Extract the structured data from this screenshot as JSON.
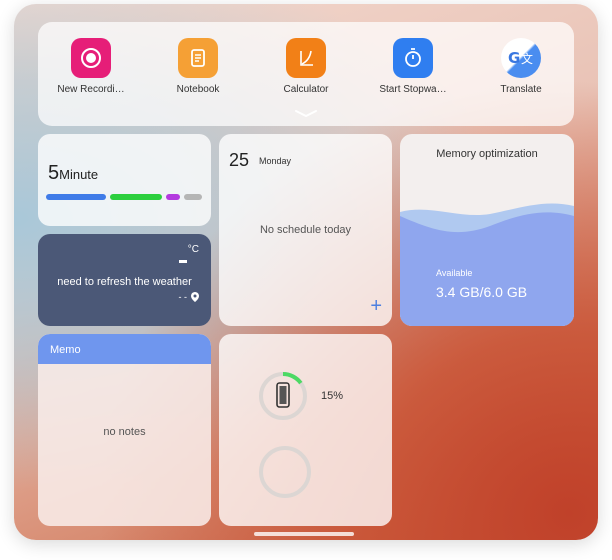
{
  "apps": [
    {
      "label": "New Recordi…",
      "icon": "record-icon",
      "color": "#e61e78"
    },
    {
      "label": "Notebook",
      "icon": "notebook-icon",
      "color": "#f5a035"
    },
    {
      "label": "Calculator",
      "icon": "calculator-icon",
      "color": "#f28017"
    },
    {
      "label": "Start Stopwa…",
      "icon": "stopwatch-icon",
      "color": "#2f7ef0"
    },
    {
      "label": "Translate",
      "icon": "translate-icon",
      "color": "#4a8df0"
    }
  ],
  "timer": {
    "value": "5",
    "unit": "Minute"
  },
  "weather": {
    "unit": "°C",
    "message": "need to refresh the weather",
    "location": "- -"
  },
  "memo": {
    "title": "Memo",
    "empty": "no notes"
  },
  "schedule": {
    "date": "25",
    "day": "Monday",
    "empty": "No schedule today",
    "add": "+"
  },
  "battery": {
    "percent": "15%",
    "level": 0.15
  },
  "memory": {
    "title": "Memory optimization",
    "available_label": "Available",
    "size": "3.4 GB/6.0 GB"
  },
  "colors": {
    "accent": "#4d7fe0",
    "weather_bg": "#4b5877",
    "memo_header": "#6f96ee",
    "battery_ring": "#4cd964"
  }
}
